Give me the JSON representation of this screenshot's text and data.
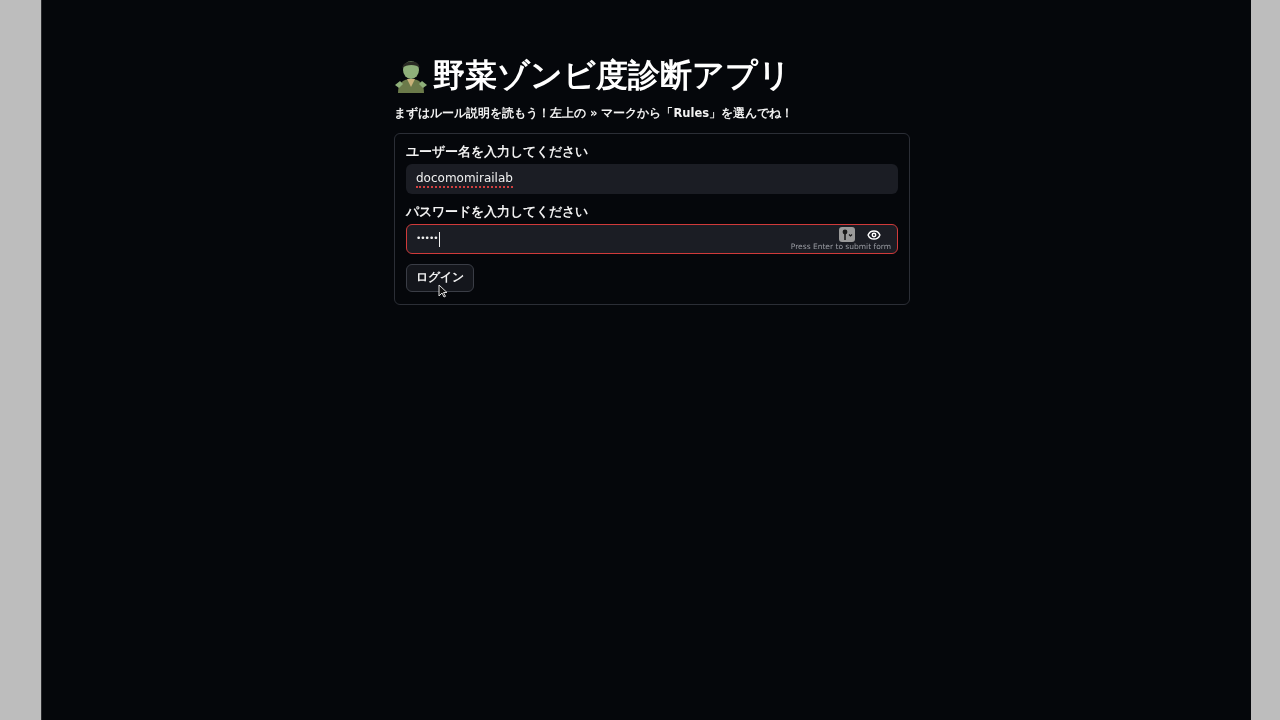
{
  "title": "野菜ゾンビ度診断アプリ",
  "subtitle": "まずはルール説明を読もう！左上の » マークから「Rules」を選んでね！",
  "form": {
    "fields": [
      {
        "kind": "text",
        "label": "ユーザー名を入力してください",
        "value": "docomomirailab",
        "focused": false,
        "misspelled": true
      },
      {
        "kind": "password",
        "label": "パスワードを入力してください",
        "value": "•••••",
        "focused": true,
        "misspelled": false,
        "hint": "Press Enter to submit form"
      }
    ],
    "submit_button": "ログイン"
  }
}
